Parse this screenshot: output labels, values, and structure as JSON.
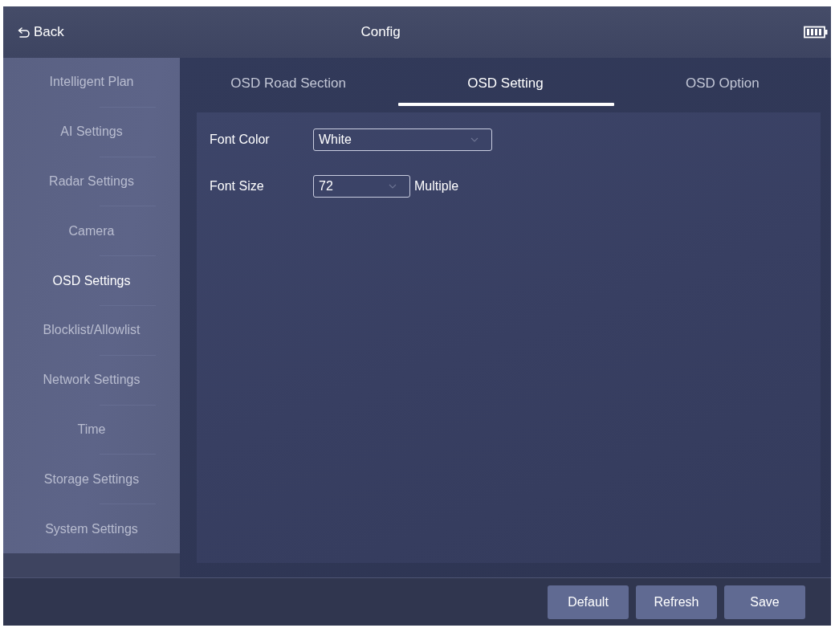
{
  "header": {
    "back_label": "Back",
    "title": "Config"
  },
  "sidebar": {
    "items": [
      {
        "label": "Intelligent Plan",
        "selected": false
      },
      {
        "label": "AI Settings",
        "selected": false
      },
      {
        "label": "Radar Settings",
        "selected": false
      },
      {
        "label": "Camera",
        "selected": false
      },
      {
        "label": "OSD Settings",
        "selected": true
      },
      {
        "label": "Blocklist/Allowlist",
        "selected": false
      },
      {
        "label": "Network Settings",
        "selected": false
      },
      {
        "label": "Time",
        "selected": false
      },
      {
        "label": "Storage Settings",
        "selected": false
      },
      {
        "label": "System Settings",
        "selected": false
      }
    ]
  },
  "tabs": [
    {
      "label": "OSD Road Section",
      "selected": false
    },
    {
      "label": "OSD Setting",
      "selected": true
    },
    {
      "label": "OSD Option",
      "selected": false
    }
  ],
  "form": {
    "fields": [
      {
        "label": "Font Color",
        "kind": "dropdown",
        "value": "White"
      },
      {
        "label": "Font Size",
        "kind": "dropdown",
        "value": "72",
        "suffix": "Multiple"
      }
    ]
  },
  "buttons": [
    "Default",
    "Refresh",
    "Save"
  ]
}
